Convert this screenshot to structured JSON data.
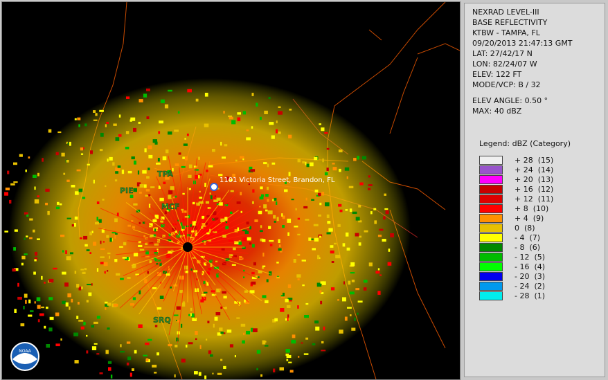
{
  "header": {
    "product": "NEXRAD LEVEL-III",
    "type": "BASE REFLECTIVITY",
    "station": "KTBW - TAMPA, FL",
    "datetime": "09/20/2013 21:47:13 GMT",
    "lat": "LAT: 27/42/17 N",
    "lon": "LON: 82/24/07 W",
    "elev": "ELEV: 122 FT",
    "mode": "MODE/VCP: B / 32",
    "elev_angle": "ELEV ANGLE: 0.50 °",
    "max": "MAX: 40 dBZ"
  },
  "legend": {
    "title": "Legend: dBZ (Category)",
    "items": [
      {
        "label": "+ 28  (15)",
        "color": "#f0f0f0"
      },
      {
        "label": "+ 24  (14)",
        "color": "#9955cc"
      },
      {
        "label": "+ 20  (13)",
        "color": "#ff00ff"
      },
      {
        "label": "+ 16  (12)",
        "color": "#c80000"
      },
      {
        "label": "+ 12  (11)",
        "color": "#dd0000"
      },
      {
        "label": "+ 8  (10)",
        "color": "#ff0000"
      },
      {
        "label": "+ 4  (9)",
        "color": "#ff9000"
      },
      {
        "label": "0  (8)",
        "color": "#e8c000"
      },
      {
        "label": "- 4  (7)",
        "color": "#ffff00"
      },
      {
        "label": "- 8  (6)",
        "color": "#008800"
      },
      {
        "label": "- 12  (5)",
        "color": "#00bb00"
      },
      {
        "label": "- 16  (4)",
        "color": "#00ff00"
      },
      {
        "label": "- 20  (3)",
        "color": "#0000ee"
      },
      {
        "label": "- 24  (2)",
        "color": "#0099ee"
      },
      {
        "label": "- 28  (1)",
        "color": "#00eeee"
      }
    ]
  },
  "map": {
    "cities": [
      "TPA",
      "PIE",
      "MCF",
      "SRQ"
    ],
    "marker_label": "1101 Victoria Street, Brandon, FL",
    "logo_text": "NOAA"
  }
}
